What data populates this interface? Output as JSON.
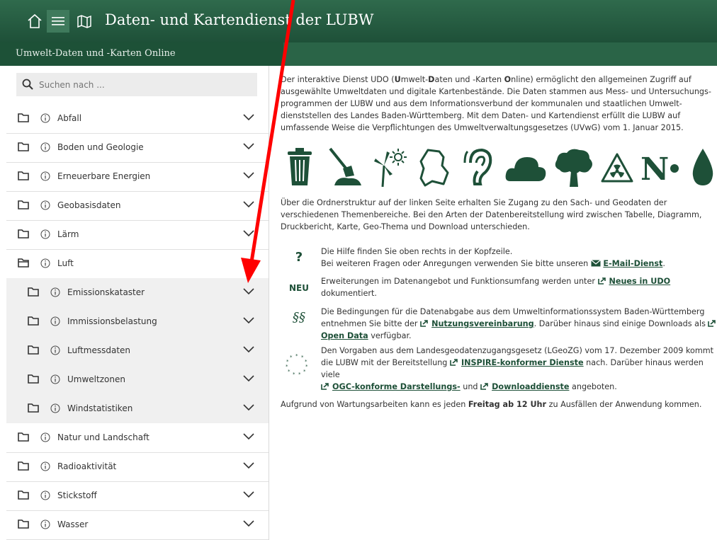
{
  "header": {
    "title": "Daten- und Kartendienst der LUBW",
    "subtitle": "Umwelt-Daten und -Karten Online"
  },
  "search": {
    "placeholder": "Suchen nach ..."
  },
  "sidebar": {
    "items": [
      {
        "label": "Abfall",
        "level": 0
      },
      {
        "label": "Boden und Geologie",
        "level": 0
      },
      {
        "label": "Erneuerbare Energien",
        "level": 0
      },
      {
        "label": "Geobasisdaten",
        "level": 0
      },
      {
        "label": "Lärm",
        "level": 0
      },
      {
        "label": "Luft",
        "level": 0,
        "open": true
      },
      {
        "label": "Emissionskataster",
        "level": 1
      },
      {
        "label": "Immissionsbelastung",
        "level": 1
      },
      {
        "label": "Luftmessdaten",
        "level": 1
      },
      {
        "label": "Umweltzonen",
        "level": 1
      },
      {
        "label": "Windstatistiken",
        "level": 1
      },
      {
        "label": "Natur und Landschaft",
        "level": 0
      },
      {
        "label": "Radioaktivität",
        "level": 0
      },
      {
        "label": "Stickstoff",
        "level": 0
      },
      {
        "label": "Wasser",
        "level": 0
      }
    ]
  },
  "intro": {
    "t1": "Der interaktive Dienst UDO (",
    "u": "U",
    "t2": "mwelt-",
    "d": "D",
    "t3": "aten und -Karten ",
    "o": "O",
    "t4": "nline) ermöglicht den allgemeinen Zugriff auf ausgewählte Umweltdaten und digitale Kartenbestände. Die Daten stammen aus Mess- und Untersuchungs-programmen der LUBW und aus dem Informationsverbund der kommunalen und staatlichen Umwelt-dienststellen des Landes Baden-Württemberg. Mit dem Daten- und Kartendienst erfüllt die LUBW auf umfassende Weise die Verpflichtungen des Umweltverwaltungsgesetzes (UVwG) vom 1. Januar 2015."
  },
  "theme_icons": [
    "trash-icon",
    "shovel-soil-icon",
    "wind-sun-icon",
    "map-bw-icon",
    "ear-icon",
    "cloud-icon",
    "tree-icon",
    "radiation-icon",
    "nitrogen-icon",
    "water-drop-icon"
  ],
  "para2": "Über die Ordnerstruktur auf der linken Seite erhalten Sie Zugang zu den Sach- und Geodaten der verschiedenen Themenbereiche. Bei den Arten der Datenbereitstellung wird zwischen Tabelle, Diagramm, Druckbericht, Karte, Geo-Thema und Download unterschieden.",
  "notes": {
    "help": {
      "badge": "?",
      "line1": "Die Hilfe finden Sie oben rechts in der Kopfzeile.",
      "line2": "Bei weiteren Fragen oder Anregungen verwenden Sie bitte unseren",
      "link": "E-Mail-Dienst",
      "end": "."
    },
    "neu": {
      "badge": "NEU",
      "t1": "Erweiterungen im Datenangebot und Funktionsumfang werden unter",
      "link": "Neues in UDO",
      "t2": "dokumentiert."
    },
    "nutzung": {
      "badge": "§§",
      "t1": "Die Bedingungen für die Datenabgabe aus dem Umweltinformationssystem Baden-Württemberg entnehmen Sie bitte der",
      "link1": "Nutzungsvereinbarung",
      "t2": ". Darüber hinaus sind einige Downloads als",
      "link2": "Open Data",
      "t3": "verfügbar."
    },
    "inspire": {
      "t1": "Den Vorgaben aus dem Landesgeodatenzugangsgesetz (LGeoZG) vom 17. Dezember 2009 kommt die LUBW mit der Bereitstellung",
      "link1": "INSPIRE-konformer Dienste",
      "t2": "nach. Darüber hinaus werden viele",
      "link2": "OGC-konforme Darstellungs-",
      "t3": "und",
      "link3": "Downloaddienste",
      "t4": "angeboten."
    }
  },
  "maintenance": {
    "t1": "Aufgrund von Wartungsarbeiten kann es jeden ",
    "bold": "Freitag ab 12 Uhr",
    "t2": " zu Ausfällen der Anwendung kommen."
  },
  "colors": {
    "brand_green": "#1e5038",
    "annotation_red": "#ff0000"
  }
}
